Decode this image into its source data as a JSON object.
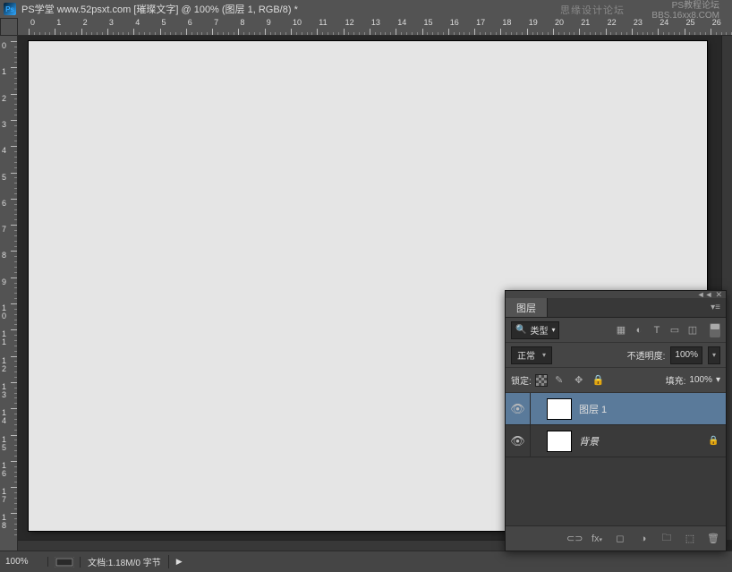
{
  "title": "PS学堂  www.52psxt.com [璀璨文字] @ 100% (图层 1, RGB/8) *",
  "watermark1": "思缘设计论坛",
  "watermark2_line1": "PS教程论坛",
  "watermark2_line2": "BBS.16xx8.COM",
  "ruler_h": [
    "0",
    "1",
    "2",
    "3",
    "4",
    "5",
    "6",
    "7",
    "8",
    "9",
    "10",
    "11",
    "12",
    "13",
    "14",
    "15",
    "16",
    "17",
    "18",
    "19",
    "20",
    "21",
    "22",
    "23",
    "24",
    "25",
    "26"
  ],
  "ruler_v": [
    "0",
    "1",
    "2",
    "3",
    "4",
    "5",
    "6",
    "7",
    "8",
    "9",
    "10",
    "11",
    "12",
    "13",
    "14",
    "15",
    "16",
    "17",
    "18"
  ],
  "status": {
    "zoom": "100%",
    "docinfo": "文档:1.18M/0 字节",
    "arrow": "▶"
  },
  "panel": {
    "tab": "图层",
    "filter_label": "类型",
    "blend_mode": "正常",
    "opacity_label": "不透明度:",
    "opacity_value": "100%",
    "lock_label": "锁定:",
    "fill_label": "填充:",
    "fill_value": "100%",
    "layers": [
      {
        "name": "图层 1",
        "selected": true,
        "locked": false
      },
      {
        "name": "背景",
        "selected": false,
        "locked": true,
        "italic": true
      }
    ]
  }
}
